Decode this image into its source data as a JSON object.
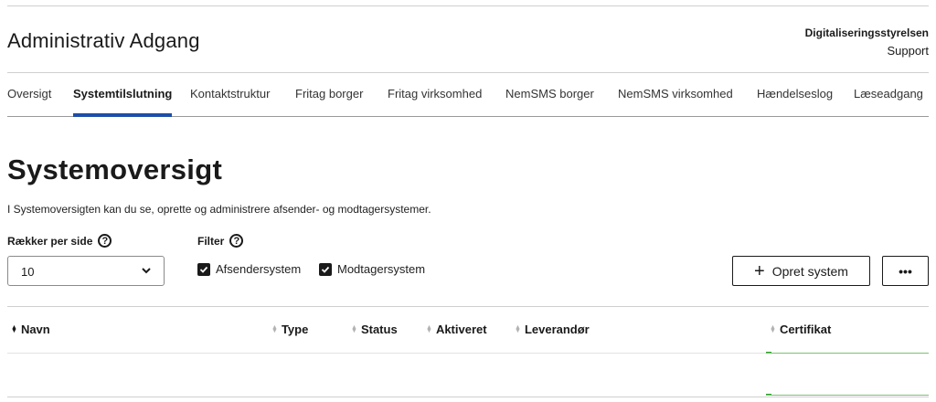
{
  "header": {
    "app_title": "Administrativ Adgang",
    "organization": "Digitaliseringsstyrelsen",
    "support_link": "Support"
  },
  "nav": {
    "items": [
      {
        "label": "Oversigt",
        "active": false
      },
      {
        "label": "Systemtilslutning",
        "active": true
      },
      {
        "label": "Kontaktstruktur",
        "active": false
      },
      {
        "label": "Fritag borger",
        "active": false
      },
      {
        "label": "Fritag virksomhed",
        "active": false
      },
      {
        "label": "NemSMS borger",
        "active": false
      },
      {
        "label": "NemSMS virksomhed",
        "active": false
      },
      {
        "label": "Hændelseslog",
        "active": false
      },
      {
        "label": "Læseadgang",
        "active": false
      }
    ],
    "accent_color": "#1d4ea8"
  },
  "main": {
    "title": "Systemoversigt",
    "description": "I Systemoversigten kan du se, oprette og administrere afsender- og modtagersystemer.",
    "rows_per_page": {
      "label": "Rækker per side",
      "value": "10",
      "icon": "help-icon",
      "help_glyph": "?"
    },
    "filter": {
      "label": "Filter",
      "icon": "help-icon",
      "help_glyph": "?",
      "options": [
        {
          "label": "Afsendersystem",
          "checked": true
        },
        {
          "label": "Modtagersystem",
          "checked": true
        }
      ]
    },
    "create_button": {
      "label": "Opret system",
      "icon": "plus-icon",
      "glyph": "+"
    },
    "more_button": {
      "label": "•••",
      "icon": "more-icon"
    }
  },
  "table": {
    "columns": [
      {
        "label": "Navn",
        "sort_active": true
      },
      {
        "label": "Type",
        "sort_active": false
      },
      {
        "label": "Status",
        "sort_active": false
      },
      {
        "label": "Aktiveret",
        "sort_active": false
      },
      {
        "label": "Leverandør",
        "sort_active": false
      },
      {
        "label": "Certifikat",
        "sort_active": false
      }
    ],
    "rows": []
  }
}
